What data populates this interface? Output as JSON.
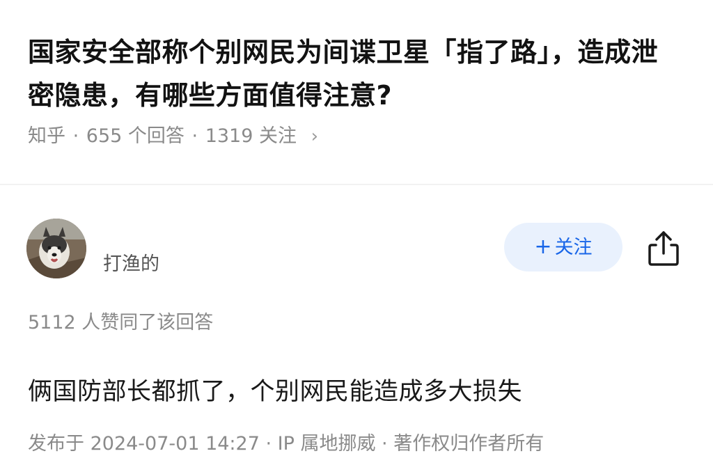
{
  "question": {
    "title": "国家安全部称个别网民为间谍卫星「指了路」，造成泄密隐患，有哪些方面值得注意?",
    "source": "知乎",
    "answers_count": "655 个回答",
    "followers_count": "1319 关注",
    "meta_separator": "·"
  },
  "author": {
    "name": "打渔的",
    "follow_label": "关注",
    "follow_prefix": "+"
  },
  "answer": {
    "votes": "5112 人赞同了该回答",
    "content": "俩国防部长都抓了，个别网民能造成多大损失",
    "published": "发布于 2024-07-01 14:27 · IP 属地挪威 · 著作权归作者所有"
  },
  "icons": {
    "chevron": "chevron-right-icon",
    "share": "share-icon",
    "avatar": "dog-avatar"
  },
  "colors": {
    "accent": "#1966e8",
    "follow_bg": "#e9f1fd",
    "meta_text": "#8a8a8a"
  }
}
